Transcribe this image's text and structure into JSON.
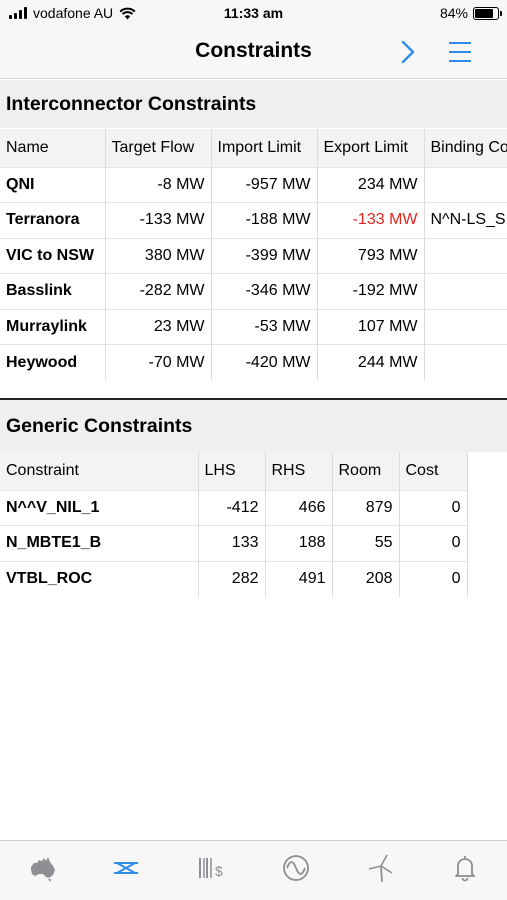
{
  "status_bar": {
    "carrier": "vodafone AU",
    "time": "11:33 am",
    "battery_percent": "84%",
    "battery_level": 0.84
  },
  "nav": {
    "title": "Constraints"
  },
  "interconnector": {
    "section_title": "Interconnector Constraints",
    "columns": [
      "Name",
      "Target Flow",
      "Import Limit",
      "Export Limit",
      "Binding Co"
    ],
    "rows": [
      {
        "name": "QNI",
        "target": "-8 MW",
        "import": "-957 MW",
        "export": "234 MW",
        "binding": ""
      },
      {
        "name": "Terranora",
        "target": "-133 MW",
        "import": "-188 MW",
        "export": "-133 MW",
        "binding": "N^N-LS_S"
      },
      {
        "name": "VIC to NSW",
        "target": "380 MW",
        "import": "-399 MW",
        "export": "793 MW",
        "binding": ""
      },
      {
        "name": "Basslink",
        "target": "-282 MW",
        "import": "-346 MW",
        "export": "-192 MW",
        "binding": ""
      },
      {
        "name": "Murraylink",
        "target": "23 MW",
        "import": "-53 MW",
        "export": "107 MW",
        "binding": ""
      },
      {
        "name": "Heywood",
        "target": "-70 MW",
        "import": "-420 MW",
        "export": "244 MW",
        "binding": ""
      }
    ]
  },
  "generic": {
    "section_title": "Generic Constraints",
    "columns": [
      "Constraint",
      "LHS",
      "RHS",
      "Room",
      "Cost"
    ],
    "rows": [
      {
        "constraint": "N^^V_NIL_1",
        "lhs": "-412",
        "rhs": "466",
        "room": "879",
        "cost": "0"
      },
      {
        "constraint": "N_MBTE1_B",
        "lhs": "133",
        "rhs": "188",
        "room": "55",
        "cost": "0"
      },
      {
        "constraint": "VTBL_ROC",
        "lhs": "282",
        "rhs": "491",
        "room": "208",
        "cost": "0"
      }
    ]
  },
  "colors": {
    "accent": "#2f8ce8",
    "alert_red": "#e0281e",
    "inactive_icon": "#8e8e93"
  },
  "tabs": [
    {
      "icon": "australia-map-icon",
      "active": false
    },
    {
      "icon": "interconnector-icon",
      "active": true
    },
    {
      "icon": "price-bars-icon",
      "active": false
    },
    {
      "icon": "sine-wave-icon",
      "active": false
    },
    {
      "icon": "wind-turbine-icon",
      "active": false
    },
    {
      "icon": "bell-icon",
      "active": false
    }
  ]
}
